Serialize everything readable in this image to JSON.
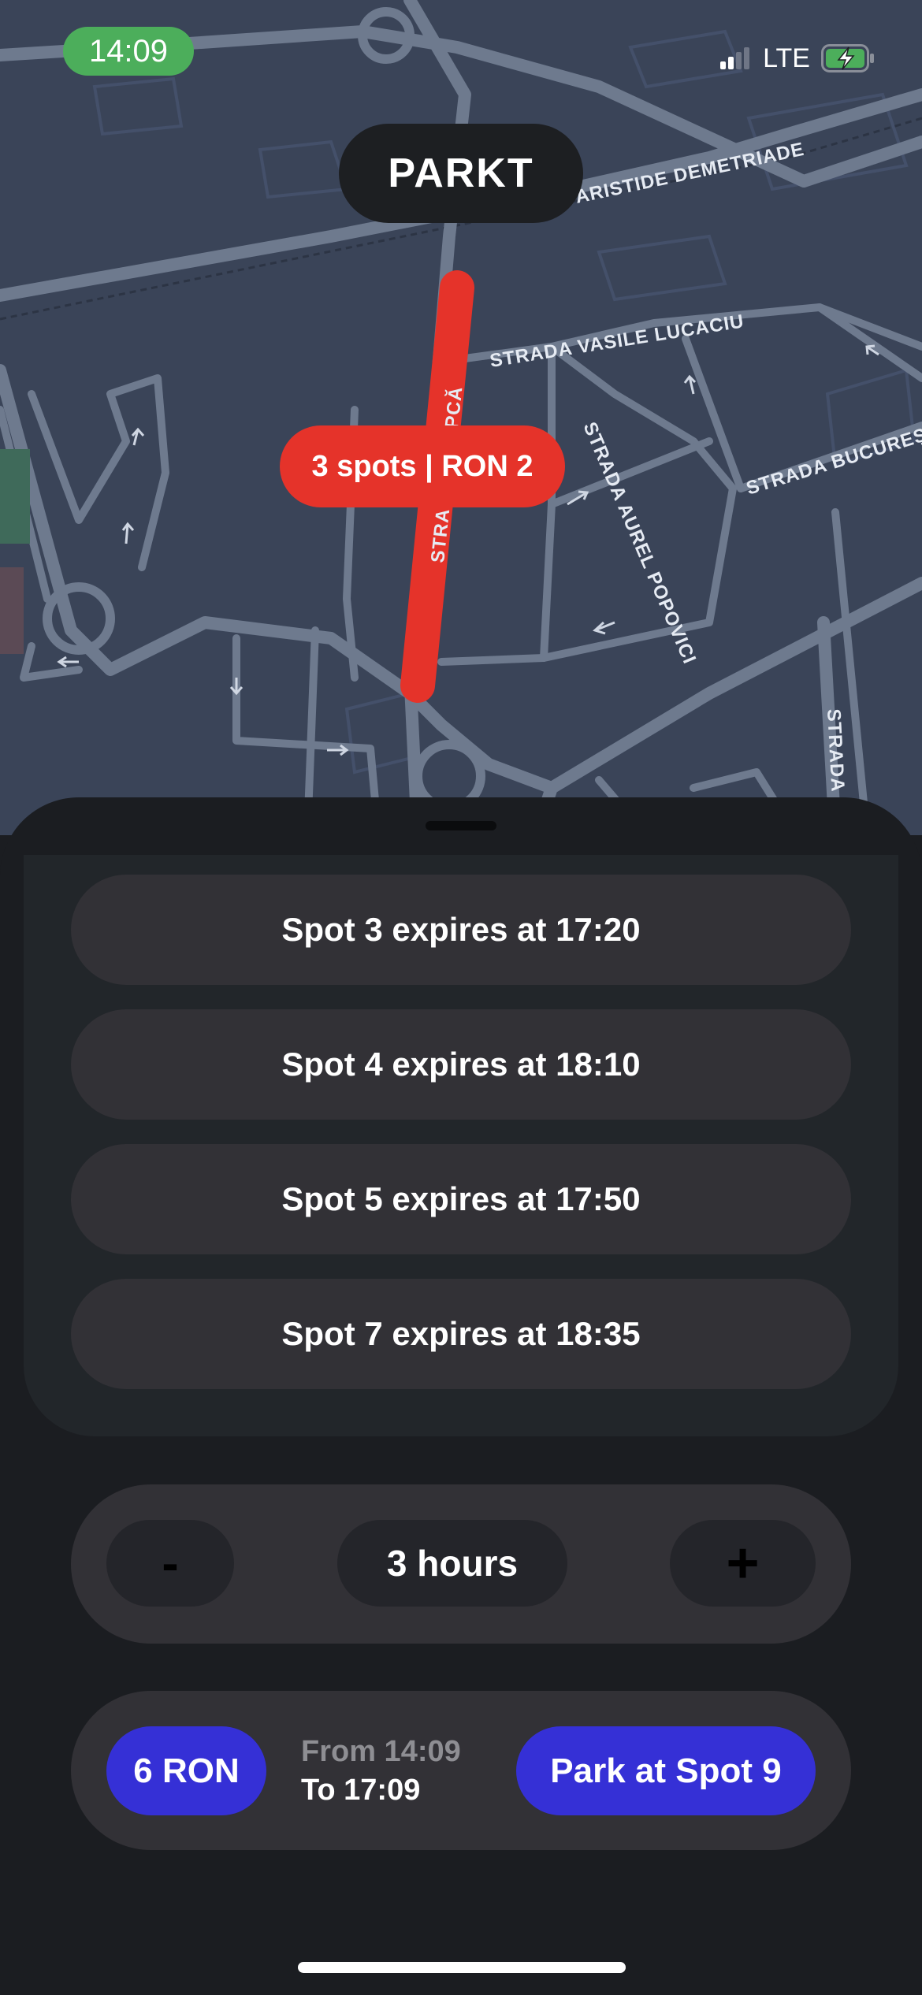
{
  "status_bar": {
    "time": "14:09",
    "network": "LTE"
  },
  "map": {
    "brand": "PARKT",
    "spots_label": "3 spots | RON 2",
    "street_labels": [
      "ARISTIDE DEMETRIADE",
      "STRADA VASILE LUCACIU",
      "STRADA BUCUREȘT",
      "STRADA AUREL POPOVICI",
      "STRA   OPA ȘAPCĂ",
      "STRADA"
    ]
  },
  "spots": [
    {
      "label": "Spot 3 expires at 17:20"
    },
    {
      "label": "Spot 4 expires at 18:10"
    },
    {
      "label": "Spot 5 expires at 17:50"
    },
    {
      "label": "Spot 7 expires at 18:35"
    }
  ],
  "duration": {
    "decrement": "-",
    "label": "3 hours",
    "increment": "+"
  },
  "payment": {
    "price": "6 RON",
    "from": "From 14:09",
    "to": "To 17:09",
    "action": "Park at Spot 9"
  },
  "colors": {
    "accent_blue": "#3530d6",
    "parking_red": "#e5332a",
    "status_green": "#4cae5b",
    "map_background": "#3a4458"
  }
}
